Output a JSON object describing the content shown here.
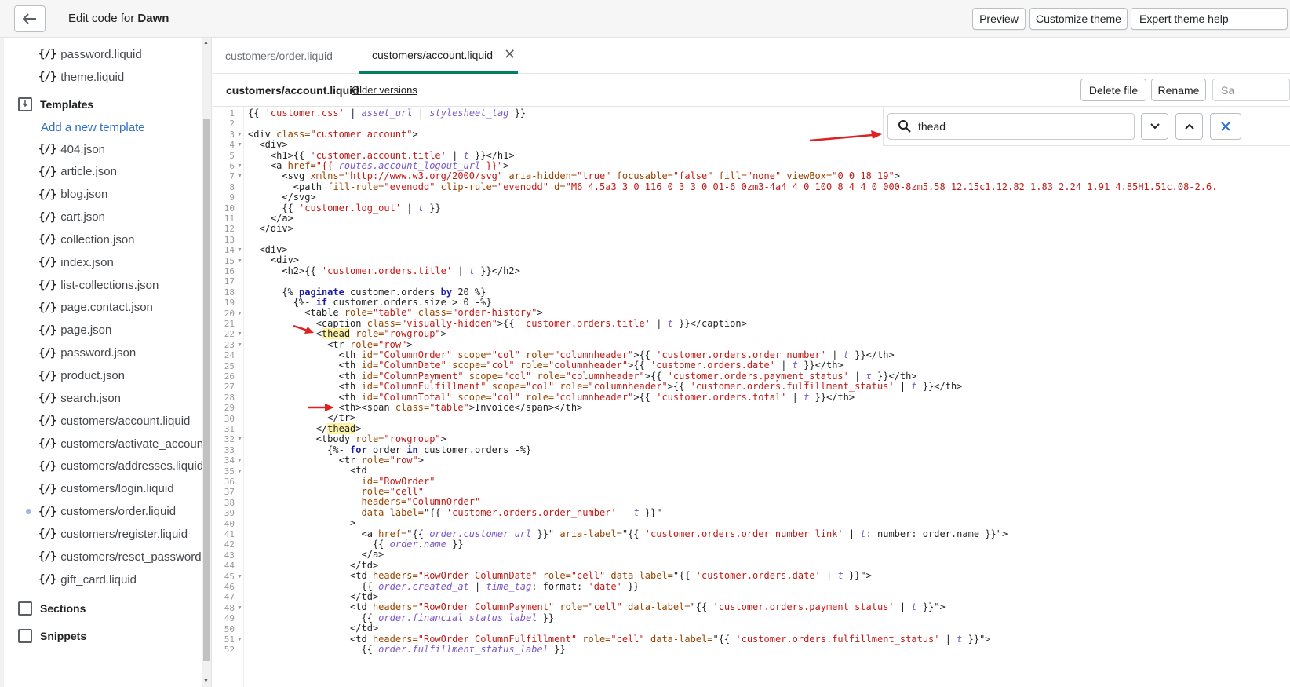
{
  "topbar": {
    "title_prefix": "Edit code for ",
    "theme_name": "Dawn",
    "preview": "Preview",
    "customize": "Customize theme",
    "expert_help": "Expert theme help"
  },
  "sidebar": {
    "top_files": [
      "password.liquid",
      "theme.liquid"
    ],
    "templates_label": "Templates",
    "add_template": "Add a new template",
    "template_files": [
      "404.json",
      "article.json",
      "blog.json",
      "cart.json",
      "collection.json",
      "index.json",
      "list-collections.json",
      "page.contact.json",
      "page.json",
      "password.json",
      "product.json",
      "search.json",
      "customers/account.liquid",
      "customers/activate_account.li",
      "customers/addresses.liquid",
      "customers/login.liquid",
      "customers/order.liquid",
      "customers/register.liquid",
      "customers/reset_password.liq",
      "gift_card.liquid"
    ],
    "sections_label": "Sections",
    "snippets_label": "Snippets",
    "file_glyph": "{/}"
  },
  "tabs": {
    "tab1": "customers/order.liquid",
    "tab2": "customers/account.liquid"
  },
  "filebar": {
    "filename": "customers/account.liquid",
    "older_versions": "Older versions",
    "delete": "Delete file",
    "rename": "Rename",
    "save": "Sa"
  },
  "search": {
    "value": "thead"
  },
  "code_lines": [
    [
      [
        "{{ ",
        "p"
      ],
      [
        "'customer.css'",
        "s"
      ],
      [
        " | ",
        "p"
      ],
      [
        "asset_url",
        "f"
      ],
      [
        " | ",
        "p"
      ],
      [
        "stylesheet_tag",
        "f"
      ],
      [
        " }}",
        "p"
      ]
    ],
    [],
    [
      [
        "<div ",
        "p"
      ],
      [
        "class=",
        "a"
      ],
      [
        "\"customer account\"",
        "s"
      ],
      [
        ">",
        "p"
      ]
    ],
    [
      [
        "  <div>",
        "p"
      ]
    ],
    [
      [
        "    <h1>{{ ",
        "p"
      ],
      [
        "'customer.account.title'",
        "s"
      ],
      [
        " | ",
        "p"
      ],
      [
        "t",
        "f"
      ],
      [
        " }}</h1>",
        "p"
      ]
    ],
    [
      [
        "    <a ",
        "p"
      ],
      [
        "href=",
        "a"
      ],
      [
        "\"{{ ",
        "s"
      ],
      [
        "routes.account_logout_url",
        "f"
      ],
      [
        " }}\"",
        "s"
      ],
      [
        ">",
        "p"
      ]
    ],
    [
      [
        "      <svg ",
        "p"
      ],
      [
        "xmlns=",
        "a"
      ],
      [
        "\"http://www.w3.org/2000/svg\"",
        "s"
      ],
      [
        " aria-hidden=",
        "a"
      ],
      [
        "\"true\"",
        "s"
      ],
      [
        " focusable=",
        "a"
      ],
      [
        "\"false\"",
        "s"
      ],
      [
        " fill=",
        "a"
      ],
      [
        "\"none\"",
        "s"
      ],
      [
        " viewBox=",
        "a"
      ],
      [
        "\"0 0 18 19\"",
        "s"
      ],
      [
        ">",
        "p"
      ]
    ],
    [
      [
        "        <path ",
        "p"
      ],
      [
        "fill-rule=",
        "a"
      ],
      [
        "\"evenodd\"",
        "s"
      ],
      [
        " clip-rule=",
        "a"
      ],
      [
        "\"evenodd\"",
        "s"
      ],
      [
        " d=",
        "a"
      ],
      [
        "\"M6 4.5a3 3 0 116 0 3 3 0 01-6 0zm3-4a4 4 0 100 8 4 4 0 000-8zm5.58 12.15c1.12.82 1.83 2.24 1.91 4.85H1.51c.08-2.6.",
        "s"
      ]
    ],
    [
      [
        "      </svg>",
        "p"
      ]
    ],
    [
      [
        "      {{ ",
        "p"
      ],
      [
        "'customer.log_out'",
        "s"
      ],
      [
        " | ",
        "p"
      ],
      [
        "t",
        "f"
      ],
      [
        " }}",
        "p"
      ]
    ],
    [
      [
        "    </a>",
        "p"
      ]
    ],
    [
      [
        "  </div>",
        "p"
      ]
    ],
    [],
    [
      [
        "  <div>",
        "p"
      ]
    ],
    [
      [
        "    <div>",
        "p"
      ]
    ],
    [
      [
        "      <h2>{{ ",
        "p"
      ],
      [
        "'customer.orders.title'",
        "s"
      ],
      [
        " | ",
        "p"
      ],
      [
        "t",
        "f"
      ],
      [
        " }}</h2>",
        "p"
      ]
    ],
    [],
    [
      [
        "      {% ",
        "p"
      ],
      [
        "paginate",
        "k"
      ],
      [
        " customer.orders ",
        "p"
      ],
      [
        "by",
        "k"
      ],
      [
        " 20 %}",
        "p"
      ]
    ],
    [
      [
        "        {%- ",
        "p"
      ],
      [
        "if",
        "k"
      ],
      [
        " customer.orders.size > 0 -%}",
        "p"
      ]
    ],
    [
      [
        "          <table ",
        "p"
      ],
      [
        "role=",
        "a"
      ],
      [
        "\"table\"",
        "s"
      ],
      [
        " class=",
        "a"
      ],
      [
        "\"order-history\"",
        "s"
      ],
      [
        ">",
        "p"
      ]
    ],
    [
      [
        "            <caption ",
        "p"
      ],
      [
        "class=",
        "a"
      ],
      [
        "\"visually-hidden\"",
        "s"
      ],
      [
        ">{{ ",
        "p"
      ],
      [
        "'customer.orders.title'",
        "s"
      ],
      [
        " | ",
        "p"
      ],
      [
        "t",
        "f"
      ],
      [
        " }}</caption>",
        "p"
      ]
    ],
    [
      [
        "            <",
        "p"
      ],
      [
        "thead",
        "h"
      ],
      [
        " role=",
        "a"
      ],
      [
        "\"rowgroup\"",
        "s"
      ],
      [
        ">",
        "p"
      ]
    ],
    [
      [
        "              <tr ",
        "p"
      ],
      [
        "role=",
        "a"
      ],
      [
        "\"row\"",
        "s"
      ],
      [
        ">",
        "p"
      ]
    ],
    [
      [
        "                <th ",
        "p"
      ],
      [
        "id=",
        "a"
      ],
      [
        "\"ColumnOrder\"",
        "s"
      ],
      [
        " scope=",
        "a"
      ],
      [
        "\"col\"",
        "s"
      ],
      [
        " role=",
        "a"
      ],
      [
        "\"columnheader\"",
        "s"
      ],
      [
        ">{{ ",
        "p"
      ],
      [
        "'customer.orders.order_number'",
        "s"
      ],
      [
        " | ",
        "p"
      ],
      [
        "t",
        "f"
      ],
      [
        " }}</th>",
        "p"
      ]
    ],
    [
      [
        "                <th ",
        "p"
      ],
      [
        "id=",
        "a"
      ],
      [
        "\"ColumnDate\"",
        "s"
      ],
      [
        " scope=",
        "a"
      ],
      [
        "\"col\"",
        "s"
      ],
      [
        " role=",
        "a"
      ],
      [
        "\"columnheader\"",
        "s"
      ],
      [
        ">{{ ",
        "p"
      ],
      [
        "'customer.orders.date'",
        "s"
      ],
      [
        " | ",
        "p"
      ],
      [
        "t",
        "f"
      ],
      [
        " }}</th>",
        "p"
      ]
    ],
    [
      [
        "                <th ",
        "p"
      ],
      [
        "id=",
        "a"
      ],
      [
        "\"ColumnPayment\"",
        "s"
      ],
      [
        " scope=",
        "a"
      ],
      [
        "\"col\"",
        "s"
      ],
      [
        " role=",
        "a"
      ],
      [
        "\"columnheader\"",
        "s"
      ],
      [
        ">{{ ",
        "p"
      ],
      [
        "'customer.orders.payment_status'",
        "s"
      ],
      [
        " | ",
        "p"
      ],
      [
        "t",
        "f"
      ],
      [
        " }}</th>",
        "p"
      ]
    ],
    [
      [
        "                <th ",
        "p"
      ],
      [
        "id=",
        "a"
      ],
      [
        "\"ColumnFulfillment\"",
        "s"
      ],
      [
        " scope=",
        "a"
      ],
      [
        "\"col\"",
        "s"
      ],
      [
        " role=",
        "a"
      ],
      [
        "\"columnheader\"",
        "s"
      ],
      [
        ">{{ ",
        "p"
      ],
      [
        "'customer.orders.fulfillment_status'",
        "s"
      ],
      [
        " | ",
        "p"
      ],
      [
        "t",
        "f"
      ],
      [
        " }}</th>",
        "p"
      ]
    ],
    [
      [
        "                <th ",
        "p"
      ],
      [
        "id=",
        "a"
      ],
      [
        "\"ColumnTotal\"",
        "s"
      ],
      [
        " scope=",
        "a"
      ],
      [
        "\"col\"",
        "s"
      ],
      [
        " role=",
        "a"
      ],
      [
        "\"columnheader\"",
        "s"
      ],
      [
        ">{{ ",
        "p"
      ],
      [
        "'customer.orders.total'",
        "s"
      ],
      [
        " | ",
        "p"
      ],
      [
        "t",
        "f"
      ],
      [
        " }}</th>",
        "p"
      ]
    ],
    [
      [
        "                <th><span ",
        "p"
      ],
      [
        "class=",
        "a"
      ],
      [
        "\"table\"",
        "s"
      ],
      [
        ">Invoice</span></th>",
        "p"
      ]
    ],
    [
      [
        "              </tr>",
        "p"
      ]
    ],
    [
      [
        "            </",
        "p"
      ],
      [
        "thead",
        "h"
      ],
      [
        ">",
        "p"
      ]
    ],
    [
      [
        "            <tbody ",
        "p"
      ],
      [
        "role=",
        "a"
      ],
      [
        "\"rowgroup\"",
        "s"
      ],
      [
        ">",
        "p"
      ]
    ],
    [
      [
        "              {%- ",
        "p"
      ],
      [
        "for",
        "k"
      ],
      [
        " order ",
        "p"
      ],
      [
        "in",
        "k"
      ],
      [
        " customer.orders -%}",
        "p"
      ]
    ],
    [
      [
        "                <tr ",
        "p"
      ],
      [
        "role=",
        "a"
      ],
      [
        "\"row\"",
        "s"
      ],
      [
        ">",
        "p"
      ]
    ],
    [
      [
        "                  <td",
        "p"
      ]
    ],
    [
      [
        "                    ",
        "p"
      ],
      [
        "id=",
        "a"
      ],
      [
        "\"RowOrder\"",
        "s"
      ]
    ],
    [
      [
        "                    ",
        "p"
      ],
      [
        "role=",
        "a"
      ],
      [
        "\"cell\"",
        "s"
      ]
    ],
    [
      [
        "                    ",
        "p"
      ],
      [
        "headers=",
        "a"
      ],
      [
        "\"ColumnOrder\"",
        "s"
      ]
    ],
    [
      [
        "                    ",
        "p"
      ],
      [
        "data-label=",
        "a"
      ],
      [
        "\"{{ ",
        "p"
      ],
      [
        "'customer.orders.order_number'",
        "s"
      ],
      [
        " | ",
        "p"
      ],
      [
        "t",
        "f"
      ],
      [
        " }}\"",
        "p"
      ]
    ],
    [
      [
        "                  >",
        "p"
      ]
    ],
    [
      [
        "                    <a ",
        "p"
      ],
      [
        "href=",
        "a"
      ],
      [
        "\"{{ ",
        "p"
      ],
      [
        "order.customer_url",
        "f"
      ],
      [
        " }}\"",
        "p"
      ],
      [
        " aria-label=",
        "a"
      ],
      [
        "\"{{ ",
        "p"
      ],
      [
        "'customer.orders.order_number_link'",
        "s"
      ],
      [
        " | ",
        "p"
      ],
      [
        "t",
        "f"
      ],
      [
        ": number: order.name }}\"",
        "p"
      ],
      [
        ">",
        "p"
      ]
    ],
    [
      [
        "                      {{ ",
        "p"
      ],
      [
        "order.name",
        "f"
      ],
      [
        " }}",
        "p"
      ]
    ],
    [
      [
        "                    </a>",
        "p"
      ]
    ],
    [
      [
        "                  </td>",
        "p"
      ]
    ],
    [
      [
        "                  <td ",
        "p"
      ],
      [
        "headers=",
        "a"
      ],
      [
        "\"RowOrder ColumnDate\"",
        "s"
      ],
      [
        " role=",
        "a"
      ],
      [
        "\"cell\"",
        "s"
      ],
      [
        " data-label=",
        "a"
      ],
      [
        "\"{{ ",
        "p"
      ],
      [
        "'customer.orders.date'",
        "s"
      ],
      [
        " | ",
        "p"
      ],
      [
        "t",
        "f"
      ],
      [
        " }}\"",
        "p"
      ],
      [
        ">",
        "p"
      ]
    ],
    [
      [
        "                    {{ ",
        "p"
      ],
      [
        "order.created_at",
        "f"
      ],
      [
        " | ",
        "p"
      ],
      [
        "time_tag",
        "f"
      ],
      [
        ": format: ",
        "p"
      ],
      [
        "'date'",
        "s"
      ],
      [
        " }}",
        "p"
      ]
    ],
    [
      [
        "                  </td>",
        "p"
      ]
    ],
    [
      [
        "                  <td ",
        "p"
      ],
      [
        "headers=",
        "a"
      ],
      [
        "\"RowOrder ColumnPayment\"",
        "s"
      ],
      [
        " role=",
        "a"
      ],
      [
        "\"cell\"",
        "s"
      ],
      [
        " data-label=",
        "a"
      ],
      [
        "\"{{ ",
        "p"
      ],
      [
        "'customer.orders.payment_status'",
        "s"
      ],
      [
        " | ",
        "p"
      ],
      [
        "t",
        "f"
      ],
      [
        " }}\"",
        "p"
      ],
      [
        ">",
        "p"
      ]
    ],
    [
      [
        "                    {{ ",
        "p"
      ],
      [
        "order.financial_status_label",
        "f"
      ],
      [
        " }}",
        "p"
      ]
    ],
    [
      [
        "                  </td>",
        "p"
      ]
    ],
    [
      [
        "                  <td ",
        "p"
      ],
      [
        "headers=",
        "a"
      ],
      [
        "\"RowOrder ColumnFulfillment\"",
        "s"
      ],
      [
        " role=",
        "a"
      ],
      [
        "\"cell\"",
        "s"
      ],
      [
        " data-label=",
        "a"
      ],
      [
        "\"{{ ",
        "p"
      ],
      [
        "'customer.orders.fulfillment_status'",
        "s"
      ],
      [
        " | ",
        "p"
      ],
      [
        "t",
        "f"
      ],
      [
        " }}\"",
        "p"
      ],
      [
        ">",
        "p"
      ]
    ],
    [
      [
        "                    {{ ",
        "p"
      ],
      [
        "order.fulfillment_status_label",
        "f"
      ],
      [
        " }}",
        "p"
      ]
    ]
  ],
  "foldable_lines": [
    3,
    4,
    6,
    7,
    14,
    15,
    20,
    22,
    23,
    32,
    34,
    35,
    45,
    48,
    51
  ],
  "colors": {
    "string": "#c41a16",
    "attr": "#994500",
    "keyword": "#1a1aa6",
    "func": "#7b58c8",
    "accent": "#008060",
    "link": "#2c6ecb",
    "highlight": "#fff3a8",
    "arrow": "#e02020"
  }
}
